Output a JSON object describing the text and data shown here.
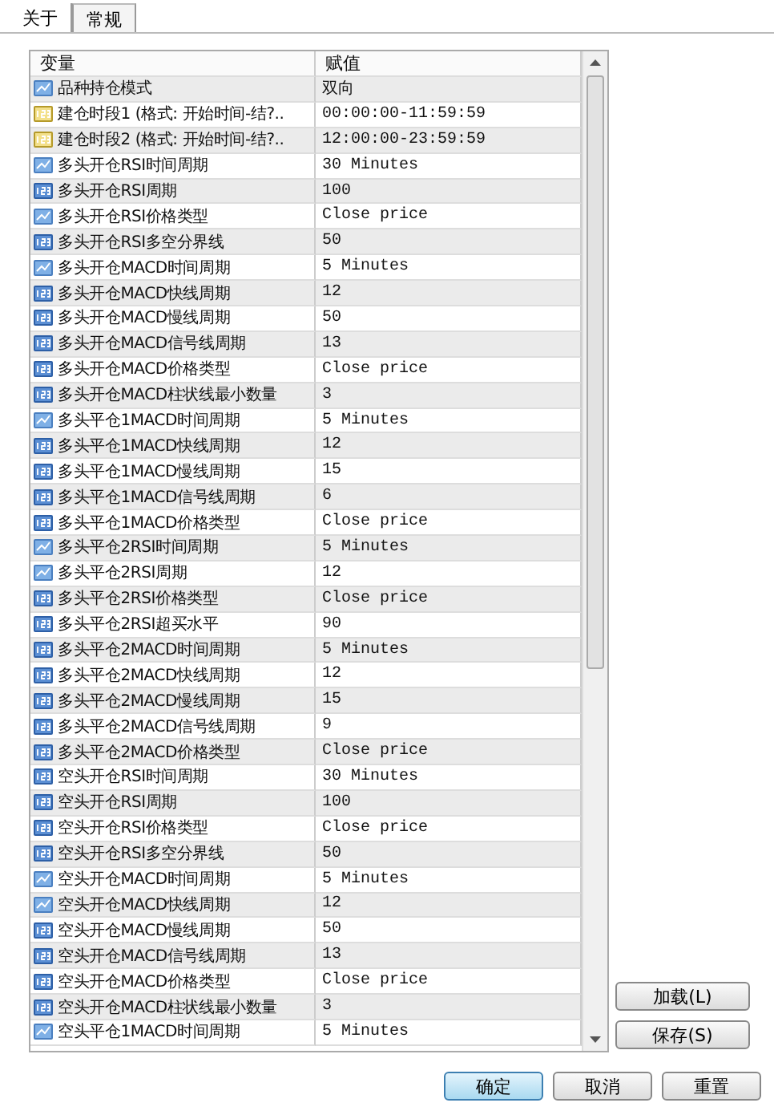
{
  "tabs": [
    {
      "label": "关于",
      "selected": false
    },
    {
      "label": "常规",
      "selected": true
    }
  ],
  "table": {
    "columns": [
      "变量",
      "赋值"
    ],
    "rows": [
      {
        "kind": "enum",
        "name": "品种持仓模式",
        "value": "双向"
      },
      {
        "kind": "string",
        "name": "建仓时段1 (格式: 开始时间-结?..",
        "value": "00:00:00-11:59:59"
      },
      {
        "kind": "string",
        "name": "建仓时段2 (格式: 开始时间-结?..",
        "value": "12:00:00-23:59:59"
      },
      {
        "kind": "enum",
        "name": "多头开仓RSI时间周期",
        "value": "30 Minutes"
      },
      {
        "kind": "int",
        "name": "多头开仓RSI周期",
        "value": "100"
      },
      {
        "kind": "enum",
        "name": "多头开仓RSI价格类型",
        "value": "Close price"
      },
      {
        "kind": "int",
        "name": "多头开仓RSI多空分界线",
        "value": "50"
      },
      {
        "kind": "enum",
        "name": "多头开仓MACD时间周期",
        "value": "5 Minutes"
      },
      {
        "kind": "int",
        "name": "多头开仓MACD快线周期",
        "value": "12"
      },
      {
        "kind": "int",
        "name": "多头开仓MACD慢线周期",
        "value": "50"
      },
      {
        "kind": "int",
        "name": "多头开仓MACD信号线周期",
        "value": "13"
      },
      {
        "kind": "int",
        "name": "多头开仓MACD价格类型",
        "value": "Close price"
      },
      {
        "kind": "int",
        "name": "多头开仓MACD柱状线最小数量",
        "value": "3"
      },
      {
        "kind": "enum",
        "name": "多头平仓1MACD时间周期",
        "value": "5 Minutes"
      },
      {
        "kind": "int",
        "name": "多头平仓1MACD快线周期",
        "value": "12"
      },
      {
        "kind": "int",
        "name": "多头平仓1MACD慢线周期",
        "value": "15"
      },
      {
        "kind": "int",
        "name": "多头平仓1MACD信号线周期",
        "value": "6"
      },
      {
        "kind": "int",
        "name": "多头平仓1MACD价格类型",
        "value": "Close price"
      },
      {
        "kind": "enum",
        "name": "多头平仓2RSI时间周期",
        "value": "5 Minutes"
      },
      {
        "kind": "enum",
        "name": "多头平仓2RSI周期",
        "value": "12"
      },
      {
        "kind": "int",
        "name": "多头平仓2RSI价格类型",
        "value": "Close price"
      },
      {
        "kind": "int",
        "name": "多头平仓2RSI超买水平",
        "value": "90"
      },
      {
        "kind": "int",
        "name": "多头平仓2MACD时间周期",
        "value": "5 Minutes"
      },
      {
        "kind": "int",
        "name": "多头平仓2MACD快线周期",
        "value": "12"
      },
      {
        "kind": "int",
        "name": "多头平仓2MACD慢线周期",
        "value": "15"
      },
      {
        "kind": "int",
        "name": "多头平仓2MACD信号线周期",
        "value": "9"
      },
      {
        "kind": "int",
        "name": "多头平仓2MACD价格类型",
        "value": "Close price"
      },
      {
        "kind": "int",
        "name": "空头开仓RSI时间周期",
        "value": "30 Minutes"
      },
      {
        "kind": "int",
        "name": "空头开仓RSI周期",
        "value": "100"
      },
      {
        "kind": "int",
        "name": "空头开仓RSI价格类型",
        "value": "Close price"
      },
      {
        "kind": "int",
        "name": "空头开仓RSI多空分界线",
        "value": "50"
      },
      {
        "kind": "enum",
        "name": "空头开仓MACD时间周期",
        "value": "5 Minutes"
      },
      {
        "kind": "enum",
        "name": "空头开仓MACD快线周期",
        "value": "12"
      },
      {
        "kind": "int",
        "name": "空头开仓MACD慢线周期",
        "value": "50"
      },
      {
        "kind": "int",
        "name": "空头开仓MACD信号线周期",
        "value": "13"
      },
      {
        "kind": "int",
        "name": "空头开仓MACD价格类型",
        "value": "Close price"
      },
      {
        "kind": "int",
        "name": "空头开仓MACD柱状线最小数量",
        "value": "3"
      },
      {
        "kind": "enum",
        "name": "空头平仓1MACD时间周期",
        "value": "5 Minutes"
      }
    ]
  },
  "side_buttons": [
    "加载(L)",
    "保存(S)"
  ],
  "buttons": [
    {
      "label": "确定",
      "default": true
    },
    {
      "label": "取消",
      "default": false
    },
    {
      "label": "重置",
      "default": false
    }
  ]
}
